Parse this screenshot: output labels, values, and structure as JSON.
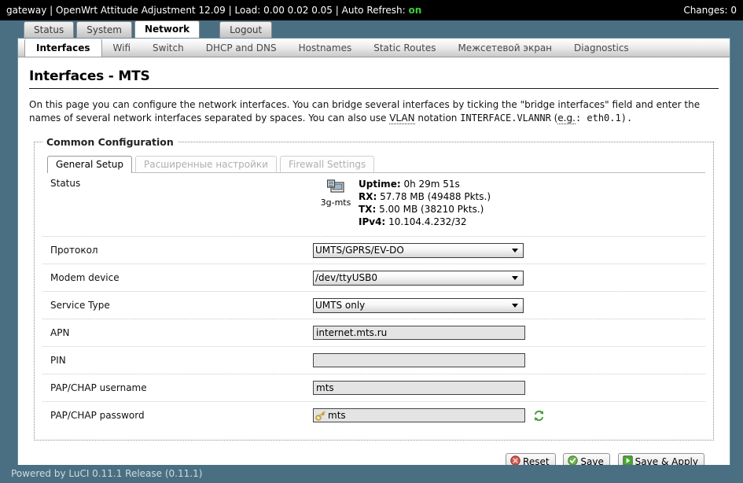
{
  "topbar": {
    "host": "gateway",
    "firmware": "OpenWrt Attitude Adjustment 12.09",
    "load": "Load: 0.00 0.02 0.05",
    "autorefresh_label": "Auto Refresh:",
    "autorefresh_state": "on",
    "changes": "Changes: 0",
    "separator": "|"
  },
  "mainmenu": [
    {
      "label": "Status",
      "active": false
    },
    {
      "label": "System",
      "active": false
    },
    {
      "label": "Network",
      "active": true
    },
    {
      "label": "Logout",
      "active": false
    }
  ],
  "submenu": [
    {
      "label": "Interfaces",
      "active": true
    },
    {
      "label": "Wifi",
      "active": false
    },
    {
      "label": "Switch",
      "active": false
    },
    {
      "label": "DHCP and DNS",
      "active": false
    },
    {
      "label": "Hostnames",
      "active": false
    },
    {
      "label": "Static Routes",
      "active": false
    },
    {
      "label": "Межсетевой экран",
      "active": false
    },
    {
      "label": "Diagnostics",
      "active": false
    }
  ],
  "page": {
    "title": "Interfaces - MTS",
    "desc_part1": "On this page you can configure the network interfaces. You can bridge several interfaces by ticking the \"bridge interfaces\" field and enter the names of several network interfaces separated by spaces. You can also use ",
    "desc_abbr": "VLAN",
    "desc_part2": " notation ",
    "desc_mono": "INTERFACE.VLANNR",
    "desc_part3": " (",
    "desc_eg": "e.g.",
    "desc_part4": ": eth0.1)."
  },
  "section": {
    "legend": "Common Configuration",
    "tabs": [
      {
        "label": "General Setup",
        "active": true
      },
      {
        "label": "Расширенные настройки",
        "active": false
      },
      {
        "label": "Firewall Settings",
        "active": false
      }
    ]
  },
  "status": {
    "label": "Status",
    "iface_name": "3g-mts",
    "uptime_label": "Uptime:",
    "uptime_value": "0h 29m 51s",
    "rx_label": "RX:",
    "rx_value": "57.78 MB (49488 Pkts.)",
    "tx_label": "TX:",
    "tx_value": "5.00 MB (38210 Pkts.)",
    "ipv4_label": "IPv4:",
    "ipv4_value": "10.104.4.232/32"
  },
  "fields": {
    "protocol": {
      "label": "Протокол",
      "value": "UMTS/GPRS/EV-DO",
      "options": [
        "UMTS/GPRS/EV-DO"
      ]
    },
    "modem_device": {
      "label": "Modem device",
      "value": "/dev/ttyUSB0",
      "options": [
        "/dev/ttyUSB0"
      ]
    },
    "service_type": {
      "label": "Service Type",
      "value": "UMTS only",
      "options": [
        "UMTS only"
      ]
    },
    "apn": {
      "label": "APN",
      "value": "internet.mts.ru",
      "placeholder": ""
    },
    "pin": {
      "label": "PIN",
      "value": "",
      "placeholder": ""
    },
    "username": {
      "label": "PAP/CHAP username",
      "value": "mts",
      "placeholder": ""
    },
    "password": {
      "label": "PAP/CHAP password",
      "value": "mts",
      "placeholder": ""
    }
  },
  "actions": {
    "reset": "Reset",
    "save": "Save",
    "save_apply": "Save & Apply"
  },
  "footer": {
    "text": "Powered by LuCI 0.11.1 Release (0.11.1)"
  },
  "colors": {
    "page_background": "#4a6f82",
    "topbar_background": "#000000",
    "accent_on": "#3cd13c",
    "reset_icon": "#c4544c",
    "save_icon": "#6ab04c",
    "apply_icon": "#3c9c30"
  }
}
